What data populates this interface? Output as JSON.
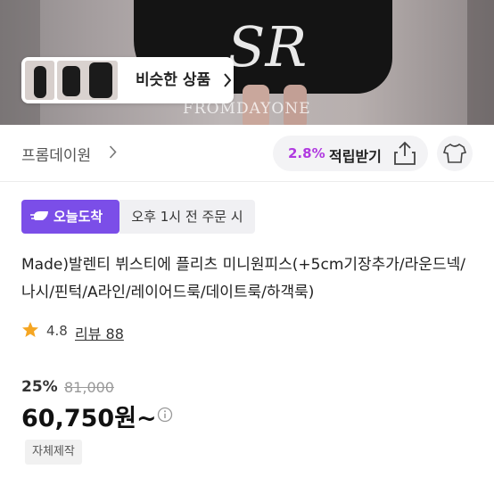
{
  "hero": {
    "watermark": "FROMDAYONE",
    "logo_mark": "SR",
    "similar_label": "비슷한 상품"
  },
  "store": {
    "name": "프롬데이원",
    "reward_percent": "2.8%",
    "reward_label": "적립받기"
  },
  "delivery": {
    "badge": "오늘도착",
    "cutoff": "오후 1시 전 주문 시"
  },
  "product": {
    "title": "Made)발렌티 뷔스티에 플리츠 미니원피스(+5cm기장추가/라운드넥/나시/핀턱/A라인/레이어드룩/데이트룩/하객룩)",
    "rating": "4.8",
    "review_label": "리뷰 88",
    "discount": "25%",
    "original_price": "81,000",
    "price": "60,750원~",
    "tag": "자체제작"
  },
  "colors": {
    "accent": "#7b4ee8",
    "reward": "#b03ae0",
    "star": "#f5a623"
  }
}
